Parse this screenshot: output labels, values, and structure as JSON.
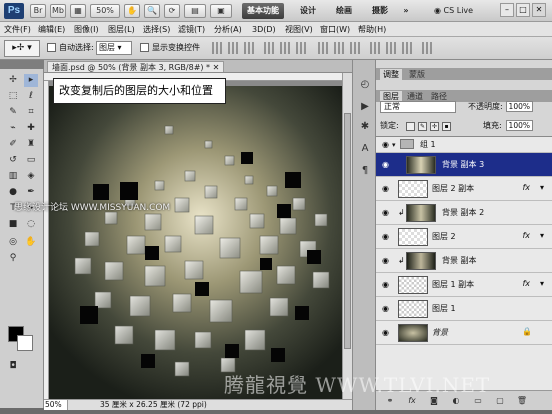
{
  "app": {
    "logo": "Ps",
    "zoom_display": "50%",
    "workspaces": [
      "基本功能",
      "设计",
      "绘画",
      "摄影"
    ],
    "active_workspace": 0,
    "cs_live": "CS Live",
    "overflow": "»"
  },
  "menu": [
    "文件(F)",
    "编辑(E)",
    "图像(I)",
    "图层(L)",
    "选择(S)",
    "滤镜(T)",
    "分析(A)",
    "3D(D)",
    "视图(V)",
    "窗口(W)",
    "帮助(H)"
  ],
  "options": {
    "auto_select_label": "自动选择:",
    "auto_select_value": "图层",
    "show_transform_label": "显示变换控件"
  },
  "document": {
    "tab_title": "墙面.psd @ 50% (背景 副本 3, RGB/8#) *",
    "zoom": "50%",
    "size_info": "35 厘米 x 26.25 厘米 (72 ppi)"
  },
  "callout": "改变复制后的图层的大小和位置",
  "panels": {
    "top_tabs": [
      "调整",
      "蒙版"
    ],
    "layer_tabs": [
      "图层",
      "通道",
      "路径"
    ],
    "blend_mode": "正常",
    "opacity_label": "不透明度:",
    "opacity": "100%",
    "lock_label": "锁定:",
    "fill_label": "填充:",
    "fill": "100%"
  },
  "layers": [
    {
      "name": "组 1",
      "kind": "group"
    },
    {
      "name": "背景 副本 3",
      "kind": "layer",
      "selected": true
    },
    {
      "name": "图层 2 副本",
      "kind": "layer",
      "fx": "fx"
    },
    {
      "name": "背景 副本 2",
      "kind": "layer"
    },
    {
      "name": "图层 2",
      "kind": "layer",
      "fx": "fx"
    },
    {
      "name": "背景 副本",
      "kind": "layer"
    },
    {
      "name": "图层 1 副本",
      "kind": "layer",
      "fx": "fx"
    },
    {
      "name": "图层 1",
      "kind": "layer"
    },
    {
      "name": "背景",
      "kind": "background"
    }
  ],
  "watermarks": [
    "思缘设计论坛 WWW.MISSYUAN.COM",
    "腾龍視覺 WWW.TLVI.NET"
  ]
}
